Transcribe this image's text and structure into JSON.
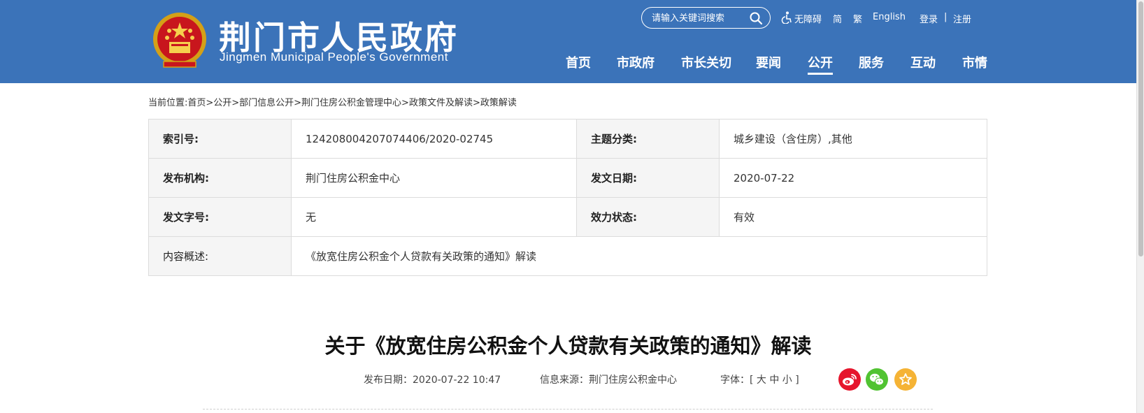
{
  "header": {
    "site_name_cn": "荆门市人民政府",
    "site_name_en": "Jingmen Municipal People's Government",
    "search": {
      "placeholder": "请输入关键词搜索"
    },
    "top_links": {
      "accessibility": "无障碍",
      "simplified": "简",
      "traditional": "繁",
      "english": "English",
      "login": "登录",
      "separator": "|",
      "register": "注册"
    },
    "nav": [
      {
        "label": "首页"
      },
      {
        "label": "市政府"
      },
      {
        "label": "市长关切"
      },
      {
        "label": "要闻"
      },
      {
        "label": "公开",
        "active": true
      },
      {
        "label": "服务"
      },
      {
        "label": "互动"
      },
      {
        "label": "市情"
      }
    ]
  },
  "breadcrumb": "当前位置:首页>公开>部门信息公开>荆门住房公积金管理中心>政策文件及解读>政策解读",
  "info": {
    "index_label": "索引号:",
    "index_value": "124208004207074406/2020-02745",
    "topic_label": "主题分类:",
    "topic_value": "城乡建设（含住房）,其他",
    "publisher_label": "发布机构:",
    "publisher_value": "荆门住房公积金中心",
    "date_label": "发文日期:",
    "date_value": "2020-07-22",
    "docno_label": "发文字号:",
    "docno_value": "无",
    "status_label": "效力状态:",
    "status_value": "有效",
    "summary_label": "内容概述:",
    "summary_value": "《放宽住房公积金个人贷款有关政策的通知》解读"
  },
  "article": {
    "title": "关于《放宽住房公积金个人贷款有关政策的通知》解读",
    "publish_date": "发布日期：2020-07-22 10:47",
    "source": "信息来源：荆门住房公积金中心",
    "font_size": "字体：[ 大 中 小 ]"
  },
  "colors": {
    "header_bg": "#3b73b9",
    "weibo": "#e6162d",
    "wechat": "#51c332",
    "favorite": "#f5b335"
  },
  "icons": [
    "national-emblem-icon",
    "search-icon",
    "accessibility-icon",
    "weibo-icon",
    "wechat-icon",
    "favorite-icon"
  ]
}
